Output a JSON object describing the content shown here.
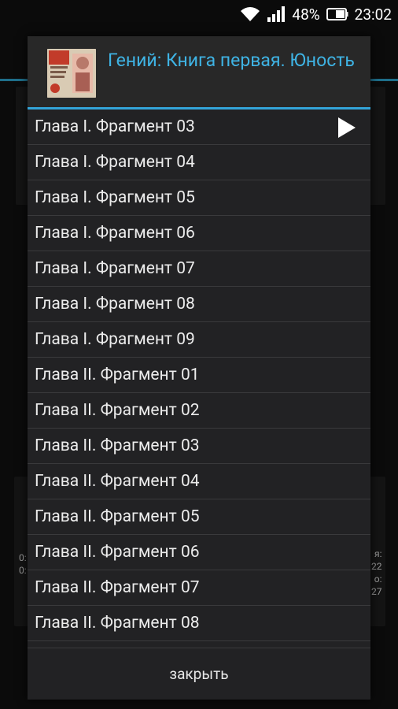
{
  "status_bar": {
    "battery": "48%",
    "time": "23:02",
    "icons": [
      "wifi-icon",
      "signal-icon",
      "battery-icon"
    ]
  },
  "background": {
    "left_text": [
      "0:",
      "0:"
    ],
    "right_text": [
      "я:",
      "22",
      "о:",
      "27"
    ]
  },
  "dialog": {
    "title": "Гений: Книга первая. Юность",
    "cover_icon": "book-cover-thumbnail",
    "accent_color": "#33a4d8",
    "items": [
      "Глава I. Фрагмент 03",
      "Глава I. Фрагмент 04",
      "Глава I. Фрагмент 05",
      "Глава I. Фрагмент 06",
      "Глава I. Фрагмент 07",
      "Глава I. Фрагмент 08",
      "Глава I. Фрагмент 09",
      "Глава II. Фрагмент 01",
      "Глава II. Фрагмент 02",
      "Глава II. Фрагмент 03",
      "Глава II. Фрагмент 04",
      "Глава II. Фрагмент 05",
      "Глава II. Фрагмент 06",
      "Глава II. Фрагмент 07",
      "Глава II. Фрагмент 08"
    ],
    "playing_index": 0,
    "close_label": "закрыть"
  }
}
